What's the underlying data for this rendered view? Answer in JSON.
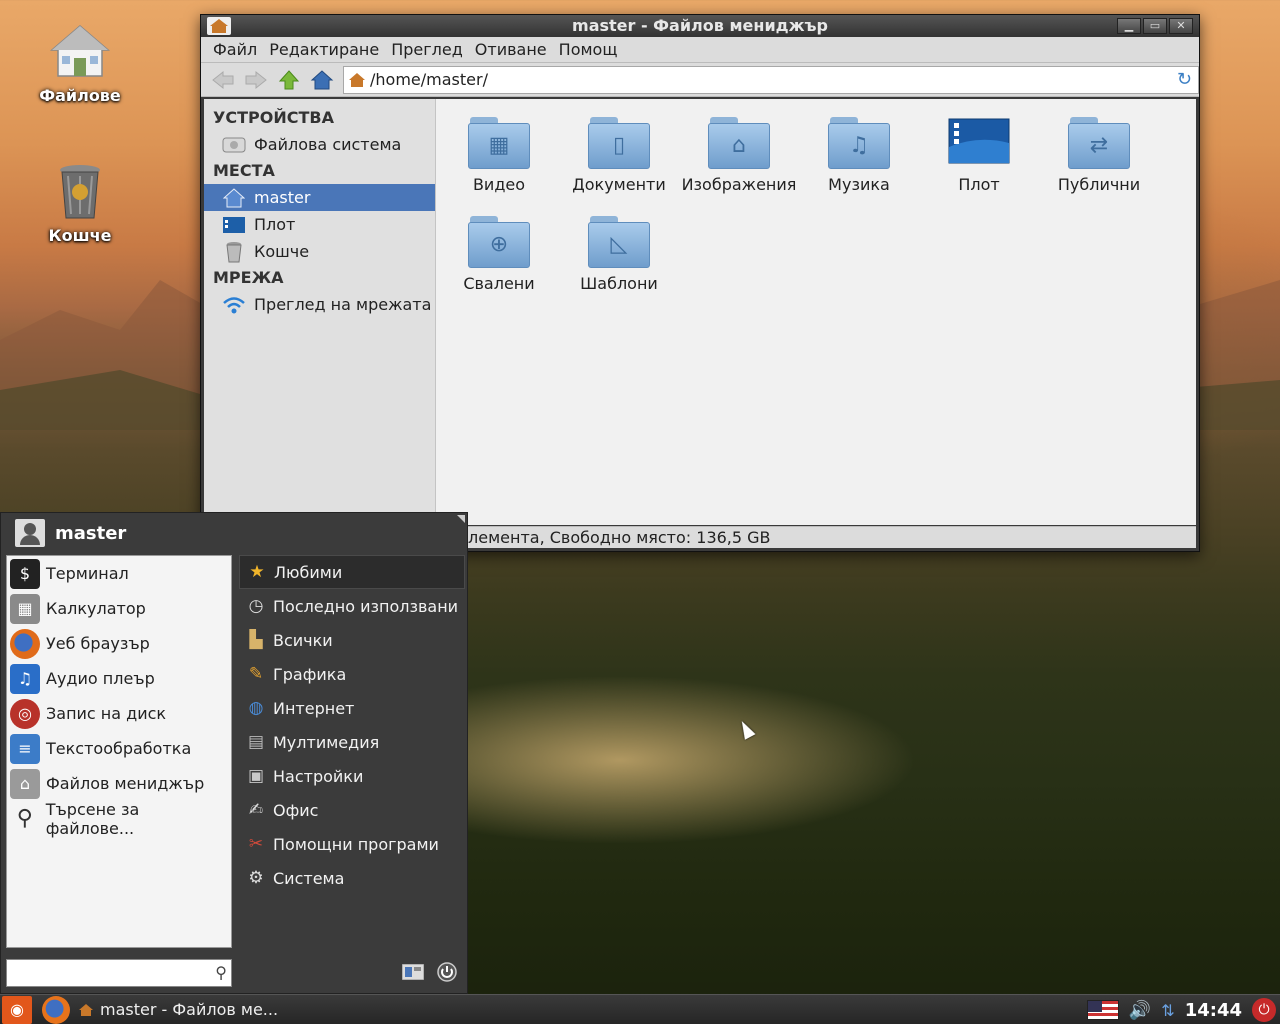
{
  "desktop": {
    "icons": [
      {
        "label": "Файлове",
        "icon": "home-folder-icon"
      },
      {
        "label": "Кошче",
        "icon": "trash-icon"
      }
    ]
  },
  "window": {
    "title": "master - Файлов мениджър",
    "menu": [
      "Файл",
      "Редактиране",
      "Преглед",
      "Отиване",
      "Помощ"
    ],
    "address": "/home/master/",
    "sidebar": {
      "sections": [
        {
          "heading": "УСТРОЙСТВА",
          "items": [
            {
              "label": "Файлова система",
              "icon": "drive-icon"
            }
          ]
        },
        {
          "heading": "МЕСТА",
          "items": [
            {
              "label": "master",
              "icon": "home-icon",
              "selected": true
            },
            {
              "label": "Плот",
              "icon": "desktop-icon"
            },
            {
              "label": "Кошче",
              "icon": "trash-icon"
            }
          ]
        },
        {
          "heading": "МРЕЖА",
          "items": [
            {
              "label": "Преглед на мрежата",
              "icon": "wifi-icon"
            }
          ]
        }
      ]
    },
    "folders": [
      {
        "label": "Видео",
        "glyph": "▦",
        "icon": "video-folder-icon"
      },
      {
        "label": "Документи",
        "glyph": "▯",
        "icon": "documents-folder-icon"
      },
      {
        "label": "Изображения",
        "glyph": "⌂",
        "icon": "pictures-folder-icon"
      },
      {
        "label": "Музика",
        "glyph": "♫",
        "icon": "music-folder-icon"
      },
      {
        "label": "Плот",
        "glyph": "",
        "icon": "desktop-folder-icon"
      },
      {
        "label": "Публични",
        "glyph": "⇄",
        "icon": "public-folder-icon"
      },
      {
        "label": "Свалени",
        "glyph": "⊕",
        "icon": "downloads-folder-icon"
      },
      {
        "label": "Шаблони",
        "glyph": "◺",
        "icon": "templates-folder-icon"
      }
    ],
    "status": "лемента, Свободно място: 136,5 GB"
  },
  "start_menu": {
    "user": "master",
    "apps": [
      {
        "label": "Терминал",
        "icon": "terminal-icon",
        "color": "#222222",
        "glyph": "$"
      },
      {
        "label": "Калкулатор",
        "icon": "calculator-icon",
        "color": "#8a8a8a",
        "glyph": "▦"
      },
      {
        "label": "Уеб браузър",
        "icon": "firefox-icon",
        "color": "#e06b1a",
        "glyph": "◉"
      },
      {
        "label": "Аудио плеър",
        "icon": "audio-player-icon",
        "color": "#2a6ec8",
        "glyph": "♫"
      },
      {
        "label": "Запис на диск",
        "icon": "disc-burner-icon",
        "color": "#b8322a",
        "glyph": "◎"
      },
      {
        "label": "Текстообработка",
        "icon": "text-editor-icon",
        "color": "#3c7cc8",
        "glyph": "≡"
      },
      {
        "label": "Файлов мениджър",
        "icon": "file-manager-icon",
        "color": "#9a9a9a",
        "glyph": "⌂"
      },
      {
        "label": "Търсене за файлове...",
        "icon": "search-files-icon",
        "color": "#777777",
        "glyph": "⚲"
      }
    ],
    "categories": [
      {
        "label": "Любими",
        "icon": "star-icon",
        "glyph": "★",
        "color": "#f1b52b",
        "selected": true
      },
      {
        "label": "Последно използвани",
        "icon": "clock-icon",
        "glyph": "◷",
        "color": "#dddddd"
      },
      {
        "label": "Всички",
        "icon": "all-apps-icon",
        "glyph": "▙",
        "color": "#d7b36a"
      },
      {
        "label": "Графика",
        "icon": "graphics-icon",
        "glyph": "✎",
        "color": "#e0a030"
      },
      {
        "label": "Интернет",
        "icon": "internet-icon",
        "glyph": "◍",
        "color": "#4a8ad4"
      },
      {
        "label": "Мултимедия",
        "icon": "multimedia-icon",
        "glyph": "▤",
        "color": "#bbbbbb"
      },
      {
        "label": "Настройки",
        "icon": "settings-icon",
        "glyph": "▣",
        "color": "#c8c8c8"
      },
      {
        "label": "Офис",
        "icon": "office-icon",
        "glyph": "✍",
        "color": "#dddddd"
      },
      {
        "label": "Помощни програми",
        "icon": "utilities-icon",
        "glyph": "✂",
        "color": "#d24a3a"
      },
      {
        "label": "Система",
        "icon": "system-gear-icon",
        "glyph": "⚙",
        "color": "#dddddd"
      }
    ],
    "search_placeholder": ""
  },
  "taskbar": {
    "task_label": "master - Файлов ме...",
    "clock": "14:44"
  }
}
